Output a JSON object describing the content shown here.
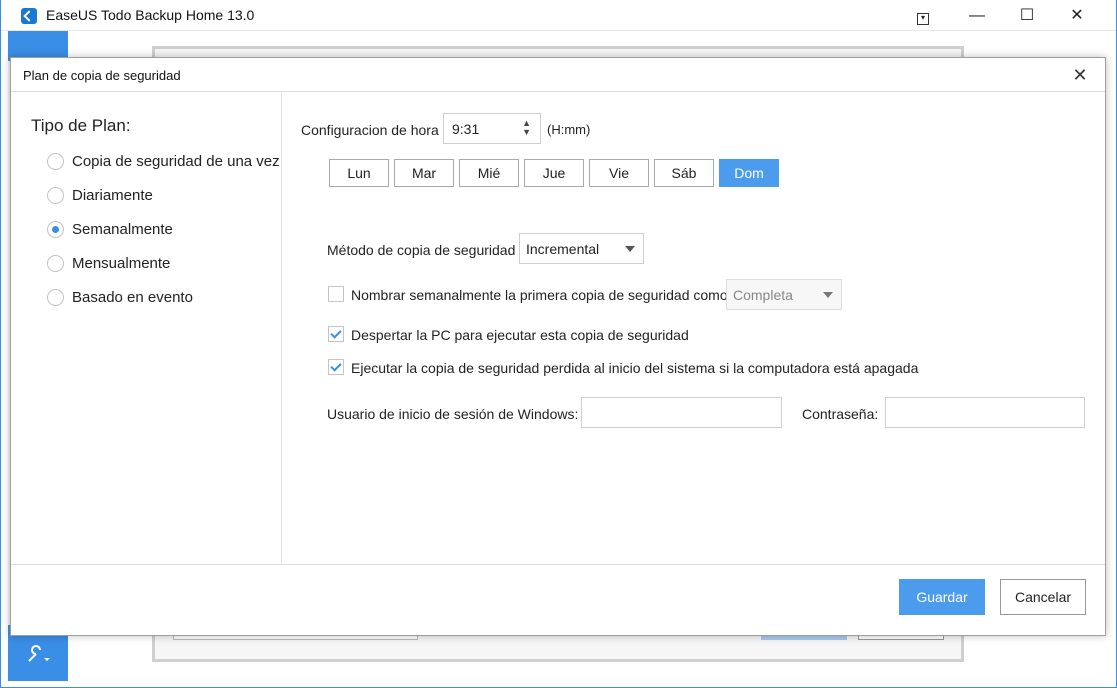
{
  "app": {
    "title": "EaseUS Todo Backup Home 13.0",
    "window_controls": {
      "menu": "▾",
      "minimize": "—",
      "maximize": "☐",
      "close": "✕"
    },
    "tools_icon": "wrench-icon"
  },
  "dialog": {
    "title": "Plan de copia de seguridad",
    "close": "✕"
  },
  "plan_type": {
    "heading": "Tipo de Plan:",
    "options": [
      {
        "label": "Copia de seguridad de una vez",
        "selected": false
      },
      {
        "label": "Diariamente",
        "selected": false
      },
      {
        "label": "Semanalmente",
        "selected": true
      },
      {
        "label": "Mensualmente",
        "selected": false
      },
      {
        "label": "Basado en evento",
        "selected": false
      }
    ]
  },
  "time": {
    "label": "Configuracion de hora",
    "value": "9:31",
    "spin": "▲▼",
    "format": "(H:mm)"
  },
  "days": [
    {
      "label": "Lun",
      "active": false
    },
    {
      "label": "Mar",
      "active": false
    },
    {
      "label": "Mié",
      "active": false
    },
    {
      "label": "Jue",
      "active": false
    },
    {
      "label": "Vie",
      "active": false
    },
    {
      "label": "Sáb",
      "active": false
    },
    {
      "label": "Dom",
      "active": true
    }
  ],
  "method": {
    "label": "Método de copia de seguridad",
    "value": "Incremental"
  },
  "options": {
    "weekly_first": {
      "label": "Nombrar semanalmente la primera copia de seguridad como",
      "checked": false,
      "select_value": "Completa"
    },
    "wake_pc": {
      "label": "Despertar la PC para ejecutar esta copia de seguridad",
      "checked": true
    },
    "run_missed": {
      "label": "Ejecutar la copia de seguridad perdida al inicio del sistema si la computadora está apagada",
      "checked": true
    }
  },
  "login": {
    "user_label": "Usuario de inicio de sesión de Windows:",
    "user_value": "",
    "password_label": "Contraseña:",
    "password_value": ""
  },
  "buttons": {
    "save": "Guardar",
    "cancel": "Cancelar"
  },
  "colors": {
    "accent": "#4c9ced",
    "app_blue": "#3a8ee6"
  }
}
